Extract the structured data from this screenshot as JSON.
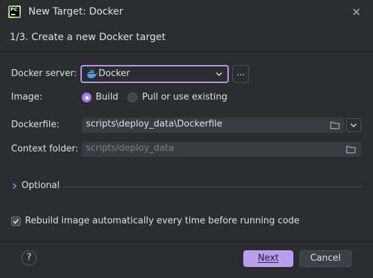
{
  "window": {
    "title": "New Target: Docker",
    "app_icon_text": "PC"
  },
  "step": {
    "title": "1/3. Create a new Docker target"
  },
  "docker_server": {
    "label": "Docker server:",
    "selected": "Docker",
    "more_label": "..."
  },
  "image": {
    "label": "Image:",
    "options": [
      {
        "label": "Build",
        "selected": true
      },
      {
        "label": "Pull or use existing",
        "selected": false
      }
    ]
  },
  "dockerfile": {
    "label": "Dockerfile:",
    "value": "scripts\\deploy_data\\Dockerfile"
  },
  "context_folder": {
    "label": "Context folder:",
    "placeholder": "scripts/deploy_data"
  },
  "optional": {
    "label": "Optional"
  },
  "rebuild": {
    "label": "Rebuild image automatically every time before running code",
    "checked": true
  },
  "footer": {
    "help": "?",
    "next_label": "Next",
    "cancel_label": "Cancel"
  },
  "colors": {
    "accent": "#b89df0",
    "background": "#2b2d30",
    "field": "#393b40"
  }
}
